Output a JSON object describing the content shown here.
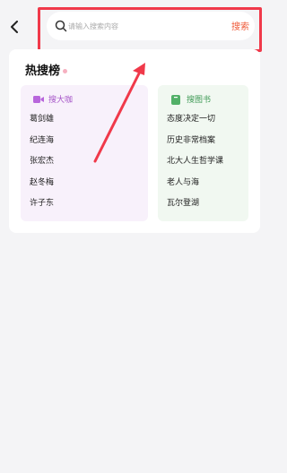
{
  "search": {
    "placeholder": "请输入搜索内容",
    "button_label": "搜索"
  },
  "hot": {
    "title": "热搜榜",
    "left_column": {
      "title": "搜大咖",
      "icon": "video-icon",
      "color": "#a656c8",
      "items": [
        "葛剑雄",
        "纪连海",
        "张宏杰",
        "赵冬梅",
        "许子东"
      ]
    },
    "right_column": {
      "title": "搜图书",
      "icon": "book-icon",
      "color": "#3f9a56",
      "items": [
        "态度决定一切",
        "历史非常档案",
        "北大人生哲学课",
        "老人与海",
        "瓦尔登湖"
      ]
    }
  },
  "colors": {
    "highlight": "#f0394a",
    "accent": "#ef5b3a"
  }
}
